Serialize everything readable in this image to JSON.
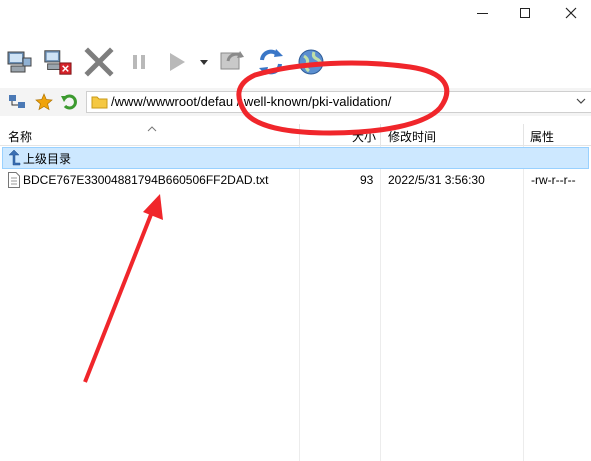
{
  "titlebar": {
    "minimize": "minimize",
    "maximize": "maximize",
    "close": "close"
  },
  "toolbar": {
    "icons": [
      "connect-icon",
      "disconnect-icon",
      "cancel-icon",
      "pause-icon",
      "play-icon",
      "dropdown-arrow-icon",
      "sync-icon",
      "refresh-icon",
      "globe-icon"
    ]
  },
  "address": {
    "path": "/www/wwwroot/defau  /.well-known/pki-validation/"
  },
  "columns": {
    "name": "名称",
    "size": "大小",
    "modified": "修改时间",
    "attributes": "属性"
  },
  "list": {
    "parent_label": "上级目录",
    "files": [
      {
        "name": "BDCE767E33004881794B660506FF2DAD.txt",
        "size": "93",
        "modified": "2022/5/31 3:56:30",
        "attributes": "-rw-r--r--"
      }
    ]
  },
  "colors": {
    "selection": "#cde8ff",
    "annotation": "#f0262b"
  }
}
